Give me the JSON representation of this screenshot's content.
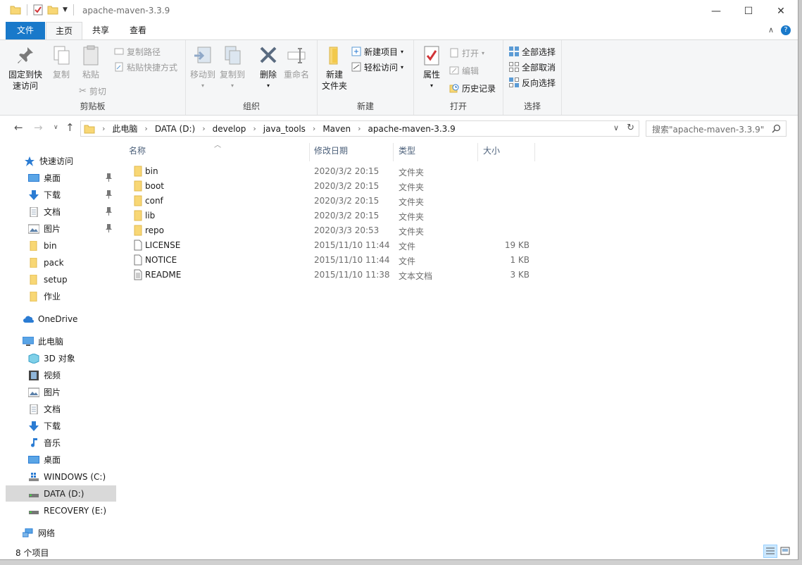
{
  "window": {
    "title": "apache-maven-3.3.9"
  },
  "tabs": {
    "file": "文件",
    "home": "主页",
    "share": "共享",
    "view": "查看"
  },
  "ribbon": {
    "clipboard": {
      "label": "剪贴板",
      "pin_line1": "固定到快",
      "pin_line2": "速访问",
      "copy": "复制",
      "paste": "粘贴",
      "copy_path": "复制路径",
      "paste_shortcut": "粘贴快捷方式",
      "cut": "剪切"
    },
    "organize": {
      "label": "组织",
      "move_to": "移动到",
      "copy_to": "复制到",
      "delete": "删除",
      "rename": "重命名"
    },
    "new": {
      "label": "新建",
      "new_folder_line1": "新建",
      "new_folder_line2": "文件夹",
      "new_item": "新建项目",
      "easy_access": "轻松访问"
    },
    "open": {
      "label": "打开",
      "properties": "属性",
      "open": "打开",
      "edit": "编辑",
      "history": "历史记录"
    },
    "select": {
      "label": "选择",
      "select_all": "全部选择",
      "select_none": "全部取消",
      "invert": "反向选择"
    }
  },
  "address": {
    "crumbs": [
      "此电脑",
      "DATA (D:)",
      "develop",
      "java_tools",
      "Maven",
      "apache-maven-3.3.9"
    ],
    "search_placeholder": "搜索\"apache-maven-3.3.9\""
  },
  "nav": {
    "quick_access": "快速访问",
    "qa_items": [
      "桌面",
      "下载",
      "文档",
      "图片",
      "bin",
      "pack",
      "setup",
      "作业"
    ],
    "onedrive": "OneDrive",
    "this_pc": "此电脑",
    "pc_items": [
      "3D 对象",
      "视频",
      "图片",
      "文档",
      "下载",
      "音乐",
      "桌面",
      "WINDOWS (C:)",
      "DATA (D:)",
      "RECOVERY (E:)"
    ],
    "network": "网络"
  },
  "columns": {
    "name": "名称",
    "date": "修改日期",
    "type": "类型",
    "size": "大小"
  },
  "files": [
    {
      "name": "bin",
      "date": "2020/3/2 20:15",
      "type": "文件夹",
      "size": ""
    },
    {
      "name": "boot",
      "date": "2020/3/2 20:15",
      "type": "文件夹",
      "size": ""
    },
    {
      "name": "conf",
      "date": "2020/3/2 20:15",
      "type": "文件夹",
      "size": ""
    },
    {
      "name": "lib",
      "date": "2020/3/2 20:15",
      "type": "文件夹",
      "size": ""
    },
    {
      "name": "repo",
      "date": "2020/3/3 20:53",
      "type": "文件夹",
      "size": ""
    },
    {
      "name": "LICENSE",
      "date": "2015/11/10 11:44",
      "type": "文件",
      "size": "19 KB"
    },
    {
      "name": "NOTICE",
      "date": "2015/11/10 11:44",
      "type": "文件",
      "size": "1 KB"
    },
    {
      "name": "README",
      "date": "2015/11/10 11:38",
      "type": "文本文档",
      "size": "3 KB"
    }
  ],
  "status": {
    "count": "8 个项目"
  },
  "colors": {
    "accent": "#1979ca",
    "folder": "#f8d775",
    "selected": "#d9d9d9"
  }
}
